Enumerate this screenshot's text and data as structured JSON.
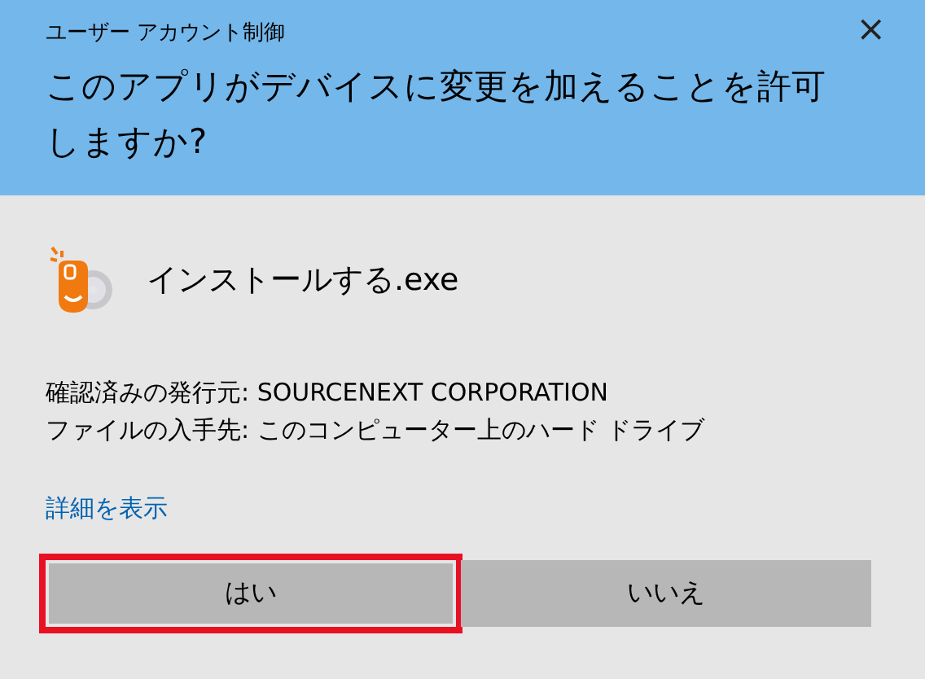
{
  "window": {
    "title": "ユーザー アカウント制御",
    "close": "×"
  },
  "question": "このアプリがデバイスに変更を加えることを許可しますか?",
  "program": {
    "name": "インストールする.exe"
  },
  "details": [
    "確認済みの発行元: SOURCENEXT CORPORATION",
    "ファイルの入手先: このコンピューター上のハード ドライブ"
  ],
  "link": "詳細を表示",
  "buttons": [
    {
      "label": "はい",
      "highlighted": true
    },
    {
      "label": "いいえ",
      "highlighted": false
    }
  ]
}
